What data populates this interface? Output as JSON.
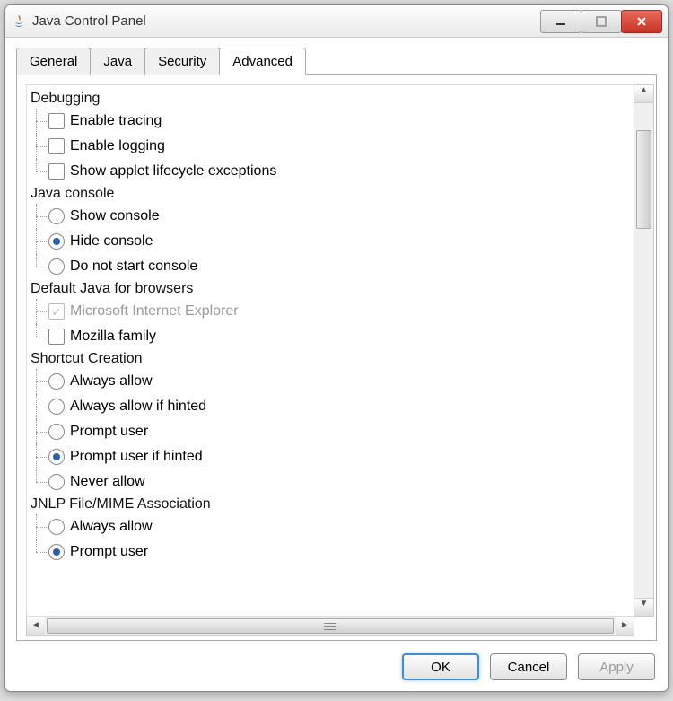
{
  "window": {
    "title": "Java Control Panel"
  },
  "tabs": [
    {
      "label": "General",
      "active": false
    },
    {
      "label": "Java",
      "active": false
    },
    {
      "label": "Security",
      "active": false
    },
    {
      "label": "Advanced",
      "active": true
    }
  ],
  "groups": [
    {
      "label": "Debugging",
      "items": [
        {
          "type": "checkbox",
          "label": "Enable tracing",
          "checked": false,
          "disabled": false
        },
        {
          "type": "checkbox",
          "label": "Enable logging",
          "checked": false,
          "disabled": false
        },
        {
          "type": "checkbox",
          "label": "Show applet lifecycle exceptions",
          "checked": false,
          "disabled": false
        }
      ]
    },
    {
      "label": "Java console",
      "items": [
        {
          "type": "radio",
          "label": "Show console",
          "selected": false,
          "disabled": false
        },
        {
          "type": "radio",
          "label": "Hide console",
          "selected": true,
          "disabled": false
        },
        {
          "type": "radio",
          "label": "Do not start console",
          "selected": false,
          "disabled": false
        }
      ]
    },
    {
      "label": "Default Java for browsers",
      "items": [
        {
          "type": "checkbox",
          "label": "Microsoft Internet Explorer",
          "checked": true,
          "disabled": true
        },
        {
          "type": "checkbox",
          "label": "Mozilla family",
          "checked": false,
          "disabled": false
        }
      ]
    },
    {
      "label": "Shortcut Creation",
      "items": [
        {
          "type": "radio",
          "label": "Always allow",
          "selected": false,
          "disabled": false
        },
        {
          "type": "radio",
          "label": "Always allow if hinted",
          "selected": false,
          "disabled": false
        },
        {
          "type": "radio",
          "label": "Prompt user",
          "selected": false,
          "disabled": false
        },
        {
          "type": "radio",
          "label": "Prompt user if hinted",
          "selected": true,
          "disabled": false
        },
        {
          "type": "radio",
          "label": "Never allow",
          "selected": false,
          "disabled": false
        }
      ]
    },
    {
      "label": "JNLP File/MIME Association",
      "items": [
        {
          "type": "radio",
          "label": "Always allow",
          "selected": false,
          "disabled": false
        },
        {
          "type": "radio",
          "label": "Prompt user",
          "selected": true,
          "disabled": false
        }
      ]
    }
  ],
  "buttons": {
    "ok": "OK",
    "cancel": "Cancel",
    "apply": "Apply"
  }
}
